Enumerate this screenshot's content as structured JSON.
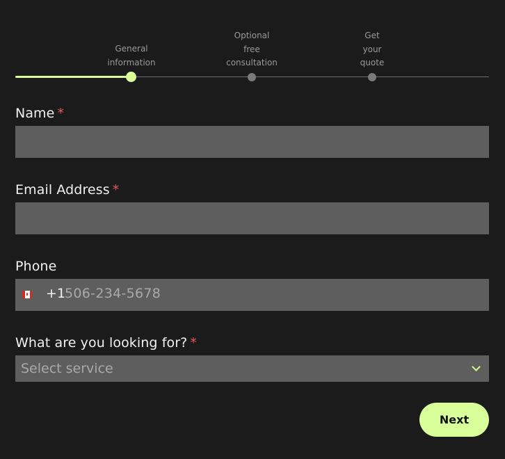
{
  "stepper": {
    "steps": [
      {
        "line1": "General",
        "line2": "information",
        "line3": ""
      },
      {
        "line1": "Optional",
        "line2": "free",
        "line3": "consultation"
      },
      {
        "line1": "Get",
        "line2": "your",
        "line3": "quote"
      }
    ],
    "current_step": 1
  },
  "form": {
    "name": {
      "label": "Name",
      "required_mark": "*",
      "value": ""
    },
    "email": {
      "label": "Email Address",
      "required_mark": "*",
      "value": ""
    },
    "phone": {
      "label": "Phone",
      "country_icon": "canada-flag-icon",
      "dial_code": "+1",
      "placeholder": "506-234-5678"
    },
    "service": {
      "label": "What are you looking for?",
      "required_mark": "*",
      "placeholder": "Select service",
      "chevron_icon": "chevron-down-icon"
    }
  },
  "actions": {
    "next_label": "Next"
  },
  "colors": {
    "background": "#1b1b1b",
    "accent": "#d8ff9a",
    "input_bg": "#5e5e5e",
    "required": "#e25a5a"
  }
}
